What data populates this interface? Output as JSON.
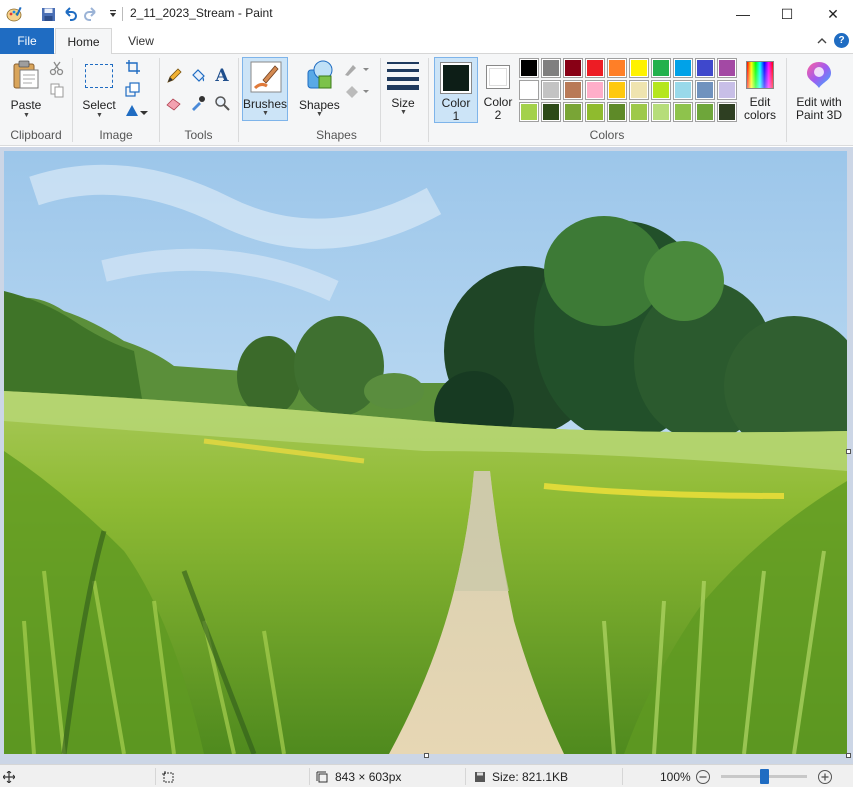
{
  "window": {
    "title": "2_11_2023_Stream - Paint",
    "controls": {
      "minimize": "—",
      "maximize": "☐",
      "close": "✕"
    }
  },
  "quick_access": {
    "app_icon": "paint-palette-icon",
    "save_icon": "save-icon",
    "undo_icon": "undo-icon",
    "redo_icon": "redo-icon",
    "customize_icon": "chevron-down-icon"
  },
  "tabs": {
    "file": "File",
    "home": "Home",
    "view": "View"
  },
  "ribbon": {
    "clipboard": {
      "paste": "Paste",
      "group": "Clipboard"
    },
    "image": {
      "select": "Select",
      "group": "Image"
    },
    "tools": {
      "group": "Tools"
    },
    "brushes": {
      "label": "Brushes"
    },
    "shapes": {
      "label": "Shapes",
      "group": "Shapes"
    },
    "size": {
      "label": "Size"
    },
    "colors": {
      "color1_label": "Color",
      "color1_num": "1",
      "color2_label": "Color",
      "color2_num": "2",
      "edit_colors_line1": "Edit",
      "edit_colors_line2": "colors",
      "group": "Colors",
      "color1_value": "#0d1e17",
      "color2_value": "#ffffff",
      "palette_row1": [
        "#000000",
        "#7f7f7f",
        "#880015",
        "#ed1c24",
        "#ff7f27",
        "#fff200",
        "#22b14c",
        "#00a2e8",
        "#3f48cc",
        "#a349a4"
      ],
      "palette_row2": [
        "#ffffff",
        "#c3c3c3",
        "#b97a57",
        "#ffaec9",
        "#ffc90e",
        "#efe4b0",
        "#b5e61d",
        "#99d9ea",
        "#7092be",
        "#c8bfe7"
      ],
      "palette_row3": [
        "#a3d14b",
        "#2c4a17",
        "#79a536",
        "#8fbb2e",
        "#5e8a28",
        "#9ec94a",
        "#b6dd7a",
        "#8ec34c",
        "#6ea63a",
        "#2e3f22"
      ]
    },
    "paint3d": {
      "line1": "Edit with",
      "line2": "Paint 3D"
    }
  },
  "status": {
    "dimensions": "843 × 603px",
    "size": "Size: 821.1KB",
    "zoom": "100%",
    "zoom_level": 1.0
  }
}
